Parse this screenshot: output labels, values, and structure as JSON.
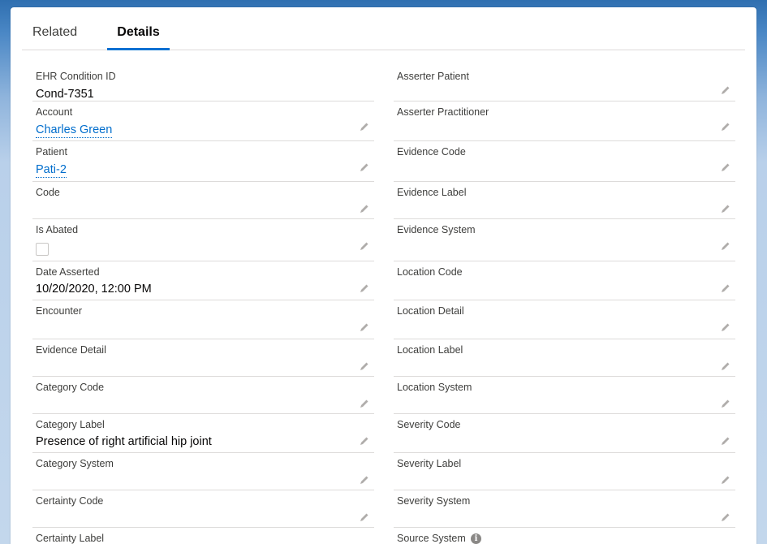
{
  "tabs": {
    "related": "Related",
    "details": "Details"
  },
  "left": {
    "ehr_condition_id": {
      "label": "EHR Condition ID",
      "value": "Cond-7351"
    },
    "account": {
      "label": "Account",
      "value": "Charles Green"
    },
    "patient": {
      "label": "Patient",
      "value": "Pati-2"
    },
    "code": {
      "label": "Code",
      "value": ""
    },
    "is_abated": {
      "label": "Is Abated",
      "checked": false
    },
    "date_asserted": {
      "label": "Date Asserted",
      "value": "10/20/2020, 12:00 PM"
    },
    "encounter": {
      "label": "Encounter",
      "value": ""
    },
    "evidence_detail": {
      "label": "Evidence Detail",
      "value": ""
    },
    "category_code": {
      "label": "Category Code",
      "value": ""
    },
    "category_label": {
      "label": "Category Label",
      "value": "Presence of right artificial hip joint"
    },
    "category_system": {
      "label": "Category System",
      "value": ""
    },
    "certainty_code": {
      "label": "Certainty Code",
      "value": ""
    },
    "certainty_label": {
      "label": "Certainty Label",
      "value": ""
    }
  },
  "right": {
    "asserter_patient": {
      "label": "Asserter Patient",
      "value": ""
    },
    "asserter_practitioner": {
      "label": "Asserter Practitioner",
      "value": ""
    },
    "evidence_code": {
      "label": "Evidence Code",
      "value": ""
    },
    "evidence_label": {
      "label": "Evidence Label",
      "value": ""
    },
    "evidence_system": {
      "label": "Evidence System",
      "value": ""
    },
    "location_code": {
      "label": "Location Code",
      "value": ""
    },
    "location_detail": {
      "label": "Location Detail",
      "value": ""
    },
    "location_label": {
      "label": "Location Label",
      "value": ""
    },
    "location_system": {
      "label": "Location System",
      "value": ""
    },
    "severity_code": {
      "label": "Severity Code",
      "value": ""
    },
    "severity_label": {
      "label": "Severity Label",
      "value": ""
    },
    "severity_system": {
      "label": "Severity System",
      "value": ""
    },
    "source_system": {
      "label": "Source System",
      "value": ""
    }
  },
  "icons": {
    "edit": "pencil-icon",
    "info": "info-icon"
  },
  "colors": {
    "link": "#006dcc",
    "active_tab": "#0070d2"
  }
}
